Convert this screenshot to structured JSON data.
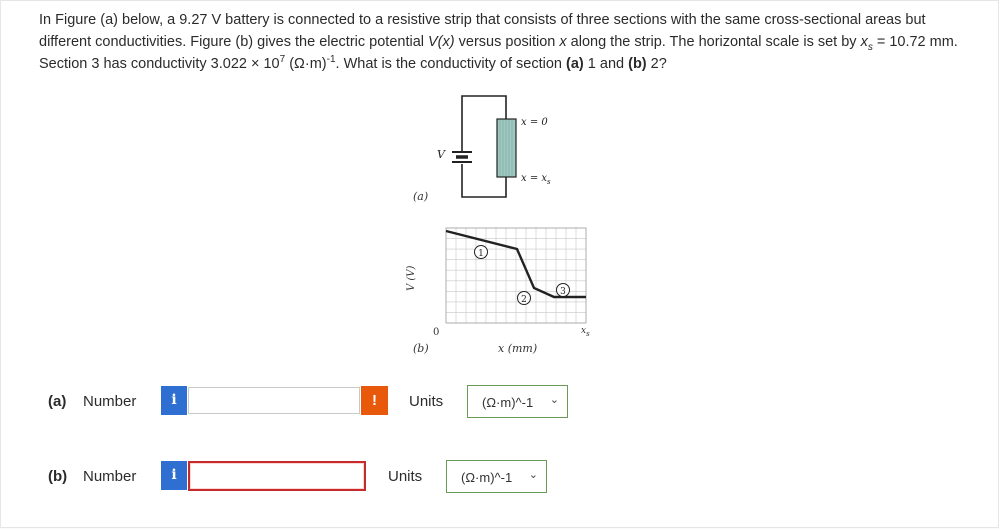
{
  "question": {
    "part1": "In Figure (a) below, a 9.27 V battery is connected to a resistive strip that consists of three sections with the same cross-sectional areas but different conductivities. Figure (b) gives the electric potential ",
    "vx": "V(x)",
    "part2": " versus position ",
    "x": "x",
    "part3": " along the strip. The horizontal scale is set by ",
    "xs_x": "x",
    "xs_sub": "s",
    "part4": " = 10.72 mm. Section 3 has conductivity 3.022 × 10",
    "exp7": "7",
    "part5": " (Ω·m)",
    "expneg1": "-1",
    "part6": ". What is the conductivity of section ",
    "a_label": "(a)",
    "part7": " 1 and ",
    "b_label": "(b)",
    "part8": " 2?"
  },
  "figure_a": {
    "battery_label": "V",
    "top_label": "x = 0",
    "bottom_label_x": "x = x",
    "bottom_label_sub": "s",
    "caption": "(a)"
  },
  "figure_b": {
    "ylabel": "V (V)",
    "origin_label": "0",
    "xs_label_x": "x",
    "xs_label_sub": "s",
    "xlabel": "x (mm)",
    "caption": "(b)",
    "section_labels": [
      "1",
      "2",
      "3"
    ]
  },
  "answers": [
    {
      "part_label": "(a)",
      "field_label": "Number",
      "info_icon": "i",
      "value": "",
      "alert_icon": "!",
      "units_label": "Units",
      "units_value": "(Ω·m)^-1"
    },
    {
      "part_label": "(b)",
      "field_label": "Number",
      "info_icon": "i",
      "value": "",
      "units_label": "Units",
      "units_value": "(Ω·m)^-1"
    }
  ],
  "colors": {
    "info_blue": "#2e6fd1",
    "alert_orange": "#e8590c",
    "invalid_red": "#c42b2b",
    "select_green_border": "#6a9a55",
    "strip_fill": "#9ec9c0"
  }
}
